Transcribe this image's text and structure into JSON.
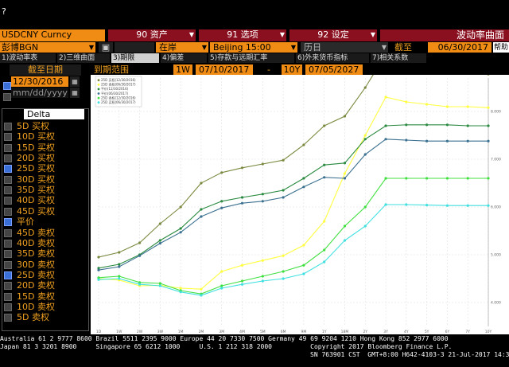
{
  "top_icon": "?",
  "header": {
    "ticker": "USDCNY Curncy",
    "menu1": "90 资产",
    "menu2": "91 选项",
    "menu3": "92 设定",
    "title": "波动率曲面"
  },
  "row2": {
    "source": "彭博BGN",
    "location": "在岸",
    "timezone": "Beijing 15:00",
    "calendar": "历日",
    "asof_label": "截至",
    "asof_date": "06/30/2017",
    "help": "帮助"
  },
  "tabs": [
    "1)波动率表",
    "2)三维曲面",
    "3)期限",
    "4)偏差",
    "5)存款与远期汇率",
    "6)外来货币指标",
    "7)相关系数"
  ],
  "left": {
    "section_title": "截至日期",
    "date1": "12/30/2016",
    "date2_placeholder": "mm/dd/yyyy",
    "list_header": "Delta",
    "items": [
      {
        "label": "5D 买权",
        "checked": false
      },
      {
        "label": "10D 买权",
        "checked": false
      },
      {
        "label": "15D 买权",
        "checked": false
      },
      {
        "label": "20D 买权",
        "checked": false
      },
      {
        "label": "25D 买权",
        "checked": true
      },
      {
        "label": "30D 买权",
        "checked": false
      },
      {
        "label": "35D 买权",
        "checked": false
      },
      {
        "label": "40D 买权",
        "checked": false
      },
      {
        "label": "45D 买权",
        "checked": false
      },
      {
        "label": "平价",
        "checked": true
      },
      {
        "label": "45D 卖权",
        "checked": false
      },
      {
        "label": "40D 卖权",
        "checked": false
      },
      {
        "label": "35D 卖权",
        "checked": false
      },
      {
        "label": "30D 卖权",
        "checked": false
      },
      {
        "label": "25D 卖权",
        "checked": true
      },
      {
        "label": "20D 卖权",
        "checked": false
      },
      {
        "label": "15D 卖权",
        "checked": false
      },
      {
        "label": "10D 卖权",
        "checked": false
      },
      {
        "label": "5D 卖权",
        "checked": false
      }
    ]
  },
  "range": {
    "label": "到期范围",
    "start_code": "1W",
    "start_date": "07/10/2017",
    "dash": "-",
    "end_code": "10Y",
    "end_date": "07/05/2027"
  },
  "chart_data": {
    "type": "line",
    "x": [
      "1D",
      "1W",
      "2W",
      "3W",
      "1M",
      "2M",
      "3M",
      "4M",
      "5M",
      "6M",
      "9M",
      "1Y",
      "18M",
      "2Y",
      "3Y",
      "4Y",
      "5Y",
      "6Y",
      "7Y",
      "10Y"
    ],
    "ylim": [
      3.5,
      8.7
    ],
    "yticks": [
      4.0,
      5.0,
      6.0,
      7.0,
      8.0
    ],
    "ytick_labels": [
      "4.000",
      "5.000",
      "6.000",
      "7.000",
      "8.000"
    ],
    "grid": true,
    "legend_placement": "top-left",
    "series": [
      {
        "name": "25D 买权(12/30/2016)",
        "color": "#7a8a40",
        "values": [
          4.95,
          5.05,
          5.25,
          5.65,
          6.0,
          6.5,
          6.72,
          6.82,
          6.9,
          6.98,
          7.3,
          7.7,
          7.9,
          8.5,
          9.2,
          9.0,
          8.9,
          8.85,
          8.8,
          8.78
        ]
      },
      {
        "name": "25D 卖权(06/30/2017)",
        "color": "#ffff40",
        "values": [
          4.5,
          4.47,
          4.35,
          4.36,
          4.3,
          4.28,
          4.65,
          4.78,
          4.88,
          4.98,
          5.2,
          5.7,
          6.7,
          7.5,
          8.3,
          8.2,
          8.15,
          8.1,
          8.1,
          8.08
        ]
      },
      {
        "name": "平价(12/30/2016)",
        "color": "#2a8a40",
        "values": [
          4.72,
          4.8,
          5.0,
          5.3,
          5.55,
          5.95,
          6.12,
          6.2,
          6.27,
          6.35,
          6.6,
          6.88,
          6.92,
          7.42,
          7.7,
          7.72,
          7.72,
          7.72,
          7.7,
          7.7
        ]
      },
      {
        "name": "平价(06/30/2017)",
        "color": "#3a7090",
        "values": [
          4.68,
          4.75,
          4.98,
          5.24,
          5.47,
          5.8,
          5.98,
          6.08,
          6.12,
          6.2,
          6.42,
          6.62,
          6.6,
          7.1,
          7.42,
          7.4,
          7.38,
          7.38,
          7.38,
          7.38
        ]
      },
      {
        "name": "25D 卖权(12/30/2016)",
        "color": "#40e040",
        "values": [
          4.52,
          4.55,
          4.42,
          4.4,
          4.25,
          4.18,
          4.35,
          4.45,
          4.55,
          4.65,
          4.78,
          5.1,
          5.6,
          6.0,
          6.6,
          6.6,
          6.6,
          6.6,
          6.6,
          6.6
        ]
      },
      {
        "name": "25D 买权(06/30/2017)",
        "color": "#40e0e0",
        "values": [
          4.48,
          4.5,
          4.38,
          4.35,
          4.22,
          4.15,
          4.3,
          4.38,
          4.45,
          4.5,
          4.6,
          4.85,
          5.3,
          5.6,
          6.05,
          6.05,
          6.04,
          6.03,
          6.03,
          6.03
        ]
      }
    ]
  },
  "footer": {
    "line1": "Australia 61 2 9777 8600 Brazil 5511 2395 9000 Europe 44 20 7330 7500 Germany 49 69 9204 1210 Hong Kong 852 2977 6000",
    "line2": "Japan 81 3 3201 8900     Singapore 65 6212 1000     U.S. 1 212 318 2000          Copyright 2017 Bloomberg Finance L.P.",
    "line3": "SN 763901 CST  GMT+8:00 H642-4103-3 21-Jul-2017 14:38:00"
  }
}
